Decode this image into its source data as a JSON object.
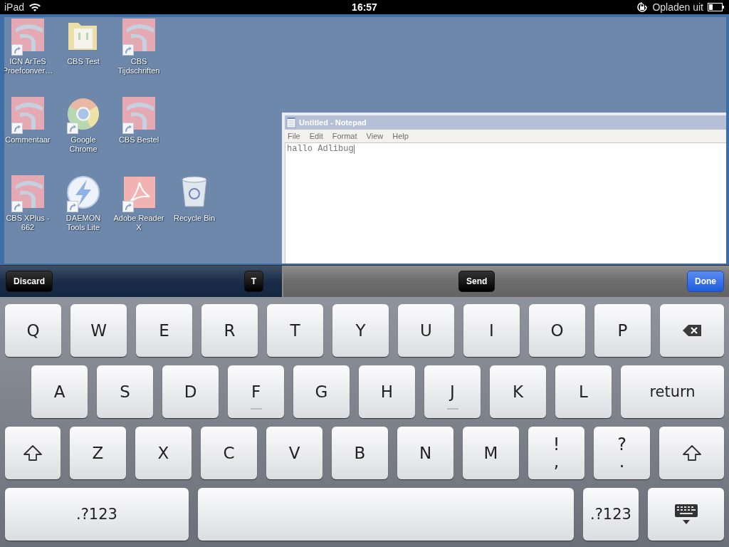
{
  "status_bar": {
    "device": "iPad",
    "time": "16:57",
    "charging": "Opladen uit"
  },
  "desktop": {
    "icons": [
      {
        "label": "ICN ArTeS Proefconver…",
        "kind": "app",
        "shortcut": true
      },
      {
        "label": "CBS Test",
        "kind": "folder",
        "shortcut": false
      },
      {
        "label": "CBS Tijdschriften",
        "kind": "app",
        "shortcut": true
      },
      {
        "label": "Commentaar",
        "kind": "app",
        "shortcut": true
      },
      {
        "label": "Google Chrome",
        "kind": "globe",
        "shortcut": true
      },
      {
        "label": "CBS Bestel",
        "kind": "app",
        "shortcut": true
      },
      {
        "label": "CBS XPlus - 662",
        "kind": "app",
        "shortcut": true
      },
      {
        "label": "DAEMON Tools Lite",
        "kind": "bolt",
        "shortcut": true
      },
      {
        "label": "Adobe Reader X",
        "kind": "reader",
        "shortcut": true
      },
      {
        "label": "Recycle Bin",
        "kind": "bin",
        "shortcut": false
      }
    ],
    "notepad": {
      "title": "Untitled - Notepad",
      "menu": [
        "File",
        "Edit",
        "Format",
        "View",
        "Help"
      ],
      "text": "hallo Adlibug"
    }
  },
  "toolbar": {
    "left": [
      "Discard",
      "T"
    ],
    "send": "Send",
    "done": "Done"
  },
  "keyboard": {
    "key_rows": [
      {
        "keys": [
          {
            "kind": "letter",
            "label": "Q",
            "homing": false
          },
          {
            "kind": "letter",
            "label": "W",
            "homing": false
          },
          {
            "kind": "letter",
            "label": "E",
            "homing": false
          },
          {
            "kind": "letter",
            "label": "R",
            "homing": false
          },
          {
            "kind": "letter",
            "label": "T",
            "homing": false
          },
          {
            "kind": "letter",
            "label": "Y",
            "homing": false
          },
          {
            "kind": "letter",
            "label": "U",
            "homing": false
          },
          {
            "kind": "letter",
            "label": "I",
            "homing": false
          },
          {
            "kind": "letter",
            "label": "O",
            "homing": false
          },
          {
            "kind": "letter",
            "label": "P",
            "homing": false
          },
          {
            "kind": "backspace"
          }
        ]
      },
      {
        "keys": [
          {
            "kind": "letter",
            "label": "A",
            "homing": false
          },
          {
            "kind": "letter",
            "label": "S",
            "homing": false
          },
          {
            "kind": "letter",
            "label": "D",
            "homing": false
          },
          {
            "kind": "letter",
            "label": "F",
            "homing": true
          },
          {
            "kind": "letter",
            "label": "G",
            "homing": false
          },
          {
            "kind": "letter",
            "label": "H",
            "homing": false
          },
          {
            "kind": "letter",
            "label": "J",
            "homing": true
          },
          {
            "kind": "letter",
            "label": "K",
            "homing": false
          },
          {
            "kind": "letter",
            "label": "L",
            "homing": false
          },
          {
            "kind": "return",
            "label": "return"
          }
        ]
      },
      {
        "keys": [
          {
            "kind": "shift"
          },
          {
            "kind": "letter",
            "label": "Z",
            "homing": false
          },
          {
            "kind": "letter",
            "label": "X",
            "homing": false
          },
          {
            "kind": "letter",
            "label": "C",
            "homing": false
          },
          {
            "kind": "letter",
            "label": "V",
            "homing": false
          },
          {
            "kind": "letter",
            "label": "B",
            "homing": false
          },
          {
            "kind": "letter",
            "label": "N",
            "homing": false
          },
          {
            "kind": "letter",
            "label": "M",
            "homing": false
          },
          {
            "kind": "punct",
            "top": "!",
            "bottom": ","
          },
          {
            "kind": "punct",
            "top": "?",
            "bottom": "."
          },
          {
            "kind": "shift"
          }
        ]
      },
      {
        "keys": [
          {
            "kind": "numbers",
            "label": ".?123"
          },
          {
            "kind": "space"
          },
          {
            "kind": "numbers",
            "label": ".?123"
          },
          {
            "kind": "hide"
          }
        ]
      }
    ]
  }
}
